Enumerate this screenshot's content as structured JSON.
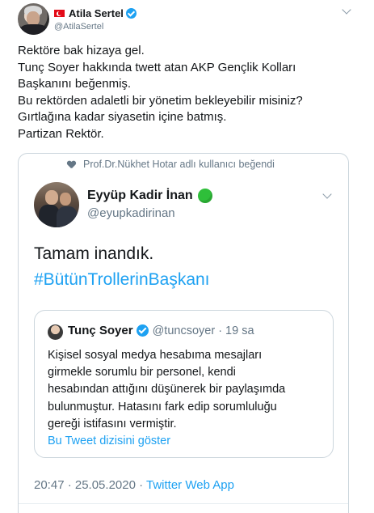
{
  "author": {
    "name": "Atila Sertel",
    "handle": "@AtilaSertel"
  },
  "tweet": {
    "lines": [
      "Rektöre bak hizaya gel.",
      "Tunç Soyer hakkında twett atan AKP Gençlik Kolları",
      "Başkanını beğenmiş.",
      "Bu rektörden adaletli bir yönetim bekleyebilir misiniz?",
      "Gırtlağına kadar siyasetin içine batmış.",
      "Partizan Rektör."
    ]
  },
  "screenshot": {
    "liked_by": "Prof.Dr.Nükhet Hotar adlı kullanıcı beğendi",
    "author_name": "Eyyüp Kadir İnan",
    "author_handle": "@eyupkadirinan",
    "text": "Tamam inandık.",
    "hashtag": "#BütünTrollerinBaşkanı",
    "quoted": {
      "name": "Tunç Soyer",
      "meta": "@tuncsoyer · 19 sa",
      "lines": [
        "Kişisel sosyal medya hesabıma mesajları",
        "girmekle sorumlu bir personel, kendi",
        "hesabından attığını düşünerek bir paylaşımda",
        "bulunmuştur. Hatasını fark edip sorumluluğu",
        "gereği istifasını vermiştir."
      ],
      "thread_link": "Bu Tweet dizisini göster"
    },
    "timestamp": "20:47 · 25.05.2020 · ",
    "source": "Twitter Web App"
  },
  "colors": {
    "accent": "#1da1f2",
    "muted": "#657786",
    "green_emoji": "#2fbf3a"
  }
}
